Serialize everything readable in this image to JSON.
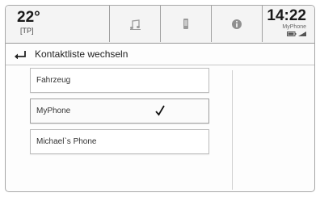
{
  "header": {
    "temperature": "22°",
    "temperature_sub": "[TP]",
    "time": "14:22",
    "phone_name": "MyPhone",
    "tabs": [
      {
        "icon": "music-note-icon"
      },
      {
        "icon": "phone-icon"
      },
      {
        "icon": "info-icon"
      }
    ]
  },
  "titlebar": {
    "back_icon": "back-arrow-icon",
    "title": "Kontaktliste wechseln"
  },
  "contact_lists": [
    {
      "label": "Fahrzeug",
      "checked": false
    },
    {
      "label": "MyPhone",
      "checked": true
    },
    {
      "label": "Michael`s Phone",
      "checked": false
    }
  ]
}
